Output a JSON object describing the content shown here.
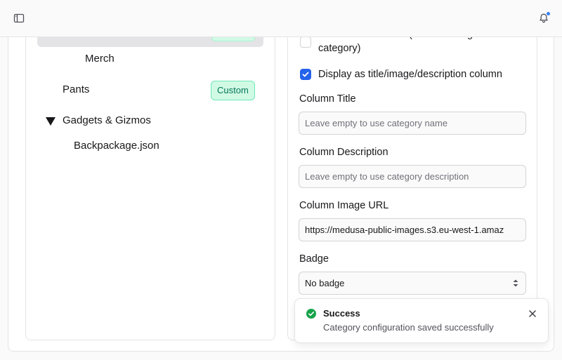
{
  "header": {
    "sidebar_toggle_icon": "sidebar-panel-icon",
    "notifications_icon": "bell-icon",
    "notification_dot_color": "#3b82f6"
  },
  "tree": {
    "items": [
      {
        "label": "Merch"
      },
      {
        "label": "Pants",
        "badge": "Custom"
      },
      {
        "label": "Gadgets & Gizmos",
        "expanded": true
      },
      {
        "label": "Backpackage.json"
      }
    ]
  },
  "form": {
    "exclude_label": "Exclude from menu (retains config but hides category)",
    "exclude_checked": false,
    "display_label": "Display as title/image/description column",
    "display_checked": true,
    "column_title": {
      "label": "Column Title",
      "placeholder": "Leave empty to use category name",
      "value": ""
    },
    "column_description": {
      "label": "Column Description",
      "placeholder": "Leave empty to use category description",
      "value": ""
    },
    "column_image_url": {
      "label": "Column Image URL",
      "value": "https://medusa-public-images.s3.eu-west-1.amaz"
    },
    "badge": {
      "label": "Badge",
      "selected": "No badge"
    }
  },
  "toast": {
    "title": "Success",
    "message": "Category configuration saved successfully",
    "icon": "check-circle-icon",
    "close_icon": "close-icon"
  },
  "colors": {
    "accent": "#2563eb",
    "success": "#16a34a",
    "badge_bg": "#d1fae5",
    "badge_text": "#047857"
  }
}
